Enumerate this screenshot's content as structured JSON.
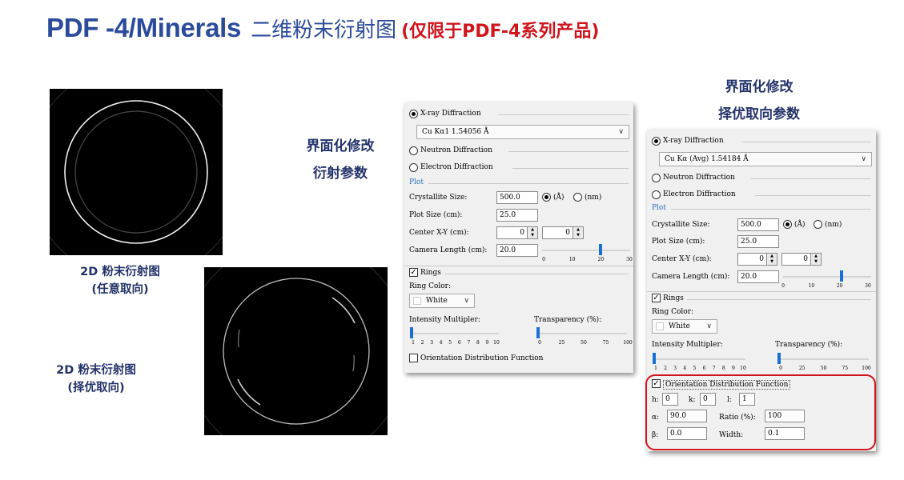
{
  "title": {
    "main": "PDF -4/Minerals",
    "sub": "二维粉末衍射图",
    "note": "(仅限于PDF-4系列产品)"
  },
  "captions": {
    "random": [
      "2D 粉末衍射图",
      "(任意取向)"
    ],
    "preferred": [
      "2D 粉末衍射图",
      "(择优取向)"
    ]
  },
  "annotations": {
    "left": [
      "界面化修改",
      "衍射参数"
    ],
    "right": [
      "界面化修改",
      "择优取向参数"
    ]
  },
  "panel1": {
    "xray_label": "X-ray Diffraction",
    "xray_selected": "Cu Kα1 1.54056 Å",
    "neutron_label": "Neutron Diffraction",
    "electron_label": "Electron Diffraction",
    "plot_label": "Plot",
    "crystallite_size_label": "Crystallite Size:",
    "crystallite_size_value": "500.0",
    "unit_angstrom": "(Å)",
    "unit_nm": "(nm)",
    "plot_size_label": "Plot Size (cm):",
    "plot_size_value": "25.0",
    "center_xy_label": "Center X-Y (cm):",
    "center_x_value": "0",
    "center_y_value": "0",
    "camera_length_label": "Camera Length (cm):",
    "camera_length_value": "20.0",
    "camera_ticks": [
      "0",
      "10",
      "20",
      "30"
    ],
    "camera_slider_value": 20,
    "rings_label": "Rings",
    "rings_checked": true,
    "ring_color_label": "Ring Color:",
    "ring_color_value": "White",
    "intensity_label": "Intensity Multipler:",
    "intensity_ticks": [
      "1",
      "2",
      "3",
      "4",
      "5",
      "6",
      "7",
      "8",
      "9",
      "10"
    ],
    "intensity_value": 1,
    "transparency_label": "Transparency (%):",
    "transparency_ticks": [
      "0",
      "25",
      "50",
      "75",
      "100"
    ],
    "transparency_value": 0,
    "odf_label": "Orientation Distribution Function",
    "odf_checked": false
  },
  "panel2": {
    "xray_label": "X-ray Diffraction",
    "xray_selected": "Cu Kα (Avg) 1.54184 Å",
    "neutron_label": "Neutron Diffraction",
    "electron_label": "Electron Diffraction",
    "plot_label": "Plot",
    "crystallite_size_label": "Crystallite Size:",
    "crystallite_size_value": "500.0",
    "unit_angstrom": "(Å)",
    "unit_nm": "(nm)",
    "plot_size_label": "Plot Size (cm):",
    "plot_size_value": "25.0",
    "center_xy_label": "Center X-Y (cm):",
    "center_x_value": "0",
    "center_y_value": "0",
    "camera_length_label": "Camera Length (cm):",
    "camera_length_value": "20.0",
    "camera_ticks": [
      "0",
      "10",
      "20",
      "30"
    ],
    "camera_slider_value": 20,
    "rings_label": "Rings",
    "rings_checked": true,
    "ring_color_label": "Ring Color:",
    "ring_color_value": "White",
    "intensity_label": "Intensity Multipler:",
    "intensity_ticks": [
      "1",
      "2",
      "3",
      "4",
      "5",
      "6",
      "7",
      "8",
      "9",
      "10"
    ],
    "intensity_value": 1,
    "transparency_label": "Transparency (%):",
    "transparency_ticks": [
      "0",
      "25",
      "50",
      "75",
      "100"
    ],
    "transparency_value": 0,
    "odf_label": "Orientation Distribution Function",
    "odf_checked": true,
    "h_label": "h:",
    "h_value": "0",
    "k_label": "k:",
    "k_value": "0",
    "l_label": "l:",
    "l_value": "1",
    "alpha_label": "α:",
    "alpha_value": "90.0",
    "ratio_label": "Ratio (%):",
    "ratio_value": "100",
    "beta_label": "β:",
    "beta_value": "0.0",
    "width_label": "Width:",
    "width_value": "0.1"
  },
  "colors": {
    "title_blue": "#2a4b9b",
    "note_red": "#d0141c",
    "caption_navy": "#24336b",
    "slider_blue": "#1a6fd6"
  }
}
